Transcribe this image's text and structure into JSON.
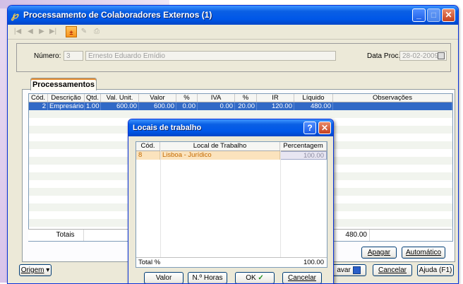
{
  "window": {
    "title": "Processamento de Colaboradores Externos (1)",
    "app_icon": "app-logo-icon",
    "controls": {
      "minimize": "_",
      "maximize": "□",
      "close": "✕"
    }
  },
  "toolbar": {
    "icons": [
      "first-record-icon",
      "prev-record-icon",
      "next-record-icon",
      "last-record-icon",
      "calculator-icon",
      "edit-icon",
      "print-icon"
    ],
    "glyphs": {
      "first": "|◀",
      "prev": "◀",
      "next": "▶",
      "last": "▶|",
      "calc": "±",
      "edit": "✎",
      "print": "⎙"
    }
  },
  "header": {
    "numero_label": "Número:",
    "numero_value": "3",
    "name_value": "Ernesto Eduardo Emídio",
    "data_proc_label": "Data Proc.:",
    "data_proc_value": "28-02-2009"
  },
  "tab": {
    "label": "Processamentos"
  },
  "grid": {
    "columns": [
      "Cód.",
      "Descrição",
      "Qtd.",
      "Val. Unit.",
      "Valor",
      "%",
      "IVA",
      "%",
      "IR",
      "Líquido",
      "Observações"
    ],
    "rows": [
      {
        "cod": "2",
        "descricao": "Empresário",
        "qtd": "1.00",
        "val_unit": "600.00",
        "valor": "600.00",
        "pct1": "0.00",
        "iva": "0.00",
        "pct2": "20.00",
        "ir": "120.00",
        "liquido": "480.00",
        "obs": ""
      }
    ],
    "totals_label": "Totais",
    "totals_liquido": "480.00"
  },
  "buttons": {
    "apagar": "Apagar",
    "automatico": "Automático",
    "origem": "Origem",
    "gravar": "avar",
    "cancelar": "Cancelar",
    "ajuda": "Ajuda (F1)"
  },
  "dialog": {
    "title": "Locais de trabalho",
    "help": "?",
    "close": "✕",
    "columns": [
      "Cód.",
      "Local de Trabalho",
      "Percentagem"
    ],
    "rows": [
      {
        "cod": "8",
        "local": "Lisboa - Jurídico",
        "percentagem": "100.00"
      }
    ],
    "total_label": "Total %",
    "total_value": "100.00",
    "buttons": {
      "valor": "Valor",
      "horas": "N.º Horas",
      "ok": "OK",
      "cancelar": "Cancelar"
    }
  }
}
